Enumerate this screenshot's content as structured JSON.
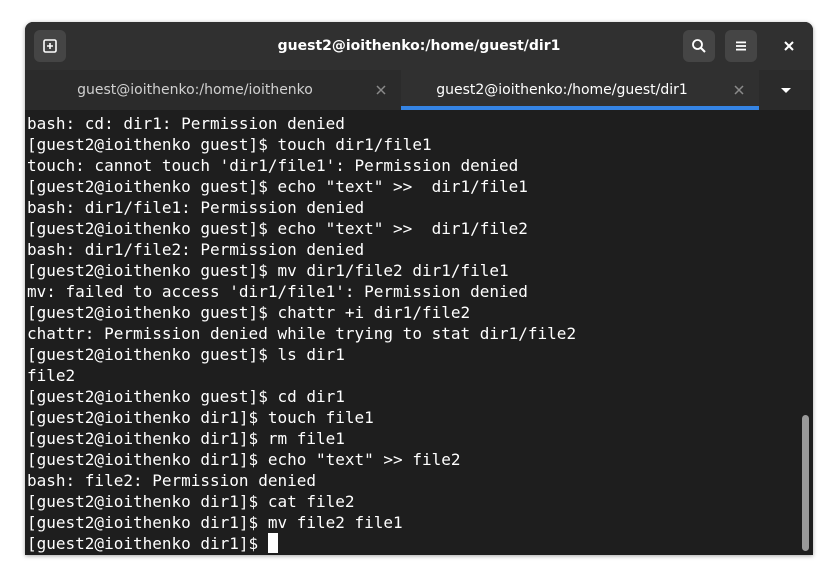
{
  "window": {
    "title": "guest2@ioithenko:/home/guest/dir1"
  },
  "tabs": [
    {
      "label": "guest@ioithenko:/home/ioithenko",
      "active": false
    },
    {
      "label": "guest2@ioithenko:/home/guest/dir1",
      "active": true
    }
  ],
  "icons": {
    "new_tab": "new-tab-icon",
    "search": "search-icon",
    "menu": "hamburger-menu-icon",
    "close": "close-icon",
    "tab_close": "close-icon",
    "tab_list": "chevron-down-icon"
  },
  "colors": {
    "accent": "#3584e4",
    "terminal_bg": "#1e1e1e",
    "terminal_fg": "#ffffff",
    "titlebar_bg": "#303030"
  },
  "terminal": {
    "lines": [
      "bash: cd: dir1: Permission denied",
      "[guest2@ioithenko guest]$ touch dir1/file1",
      "touch: cannot touch 'dir1/file1': Permission denied",
      "[guest2@ioithenko guest]$ echo \"text\" >>  dir1/file1",
      "bash: dir1/file1: Permission denied",
      "[guest2@ioithenko guest]$ echo \"text\" >>  dir1/file2",
      "bash: dir1/file2: Permission denied",
      "[guest2@ioithenko guest]$ mv dir1/file2 dir1/file1",
      "mv: failed to access 'dir1/file1': Permission denied",
      "[guest2@ioithenko guest]$ chattr +i dir1/file2",
      "chattr: Permission denied while trying to stat dir1/file2",
      "[guest2@ioithenko guest]$ ls dir1",
      "file2",
      "[guest2@ioithenko guest]$ cd dir1",
      "[guest2@ioithenko dir1]$ touch file1",
      "[guest2@ioithenko dir1]$ rm file1",
      "[guest2@ioithenko dir1]$ echo \"text\" >> file2",
      "bash: file2: Permission denied",
      "[guest2@ioithenko dir1]$ cat file2",
      "[guest2@ioithenko dir1]$ mv file2 file1"
    ],
    "prompt": "[guest2@ioithenko dir1]$ "
  }
}
